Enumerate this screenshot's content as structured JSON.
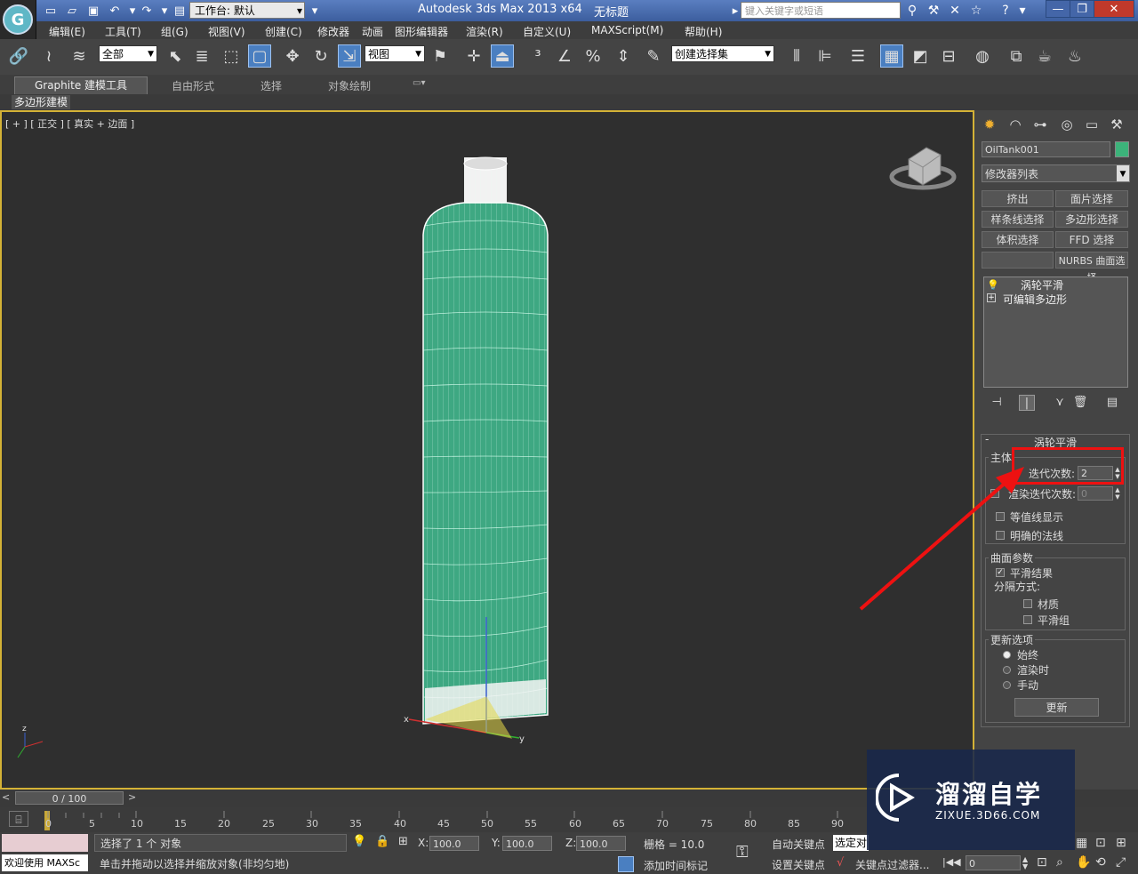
{
  "titlebar": {
    "workspace_label": "工作台: 默认",
    "app_title": "Autodesk 3ds Max  2013 x64",
    "doc_title": "无标题",
    "search_placeholder": "键入关键字或短语"
  },
  "menus": [
    "编辑(E)",
    "工具(T)",
    "组(G)",
    "视图(V)",
    "创建(C)",
    "修改器",
    "动画",
    "图形编辑器",
    "渲染(R)",
    "自定义(U)",
    "MAXScript(M)",
    "帮助(H)"
  ],
  "toolbar": {
    "filter_value": "全部",
    "refcoord_value": "视图",
    "selset_value": "创建选择集"
  },
  "ribbon": {
    "tabs": [
      "Graphite 建模工具",
      "自由形式",
      "选择",
      "对象绘制"
    ],
    "subtab": "多边形建模"
  },
  "viewport": {
    "label": "[ + ] [ 正交 ] [ 真实 + 边面 ]",
    "axis_labels": {
      "x": "x",
      "y": "y",
      "z": "z"
    }
  },
  "command_panel": {
    "object_name": "OilTank001",
    "object_color": "#3cb37a",
    "modifier_list": "修改器列表",
    "modifier_buttons": [
      "挤出",
      "面片选择",
      "样条线选择",
      "多边形选择",
      "体积选择",
      "FFD 选择",
      "",
      "NURBS 曲面选择"
    ],
    "stack": [
      "涡轮平滑",
      "可编辑多边形"
    ]
  },
  "turbosmooth": {
    "title": "涡轮平滑",
    "main_group": "主体",
    "iterations_label": "迭代次数:",
    "iterations_value": "2",
    "render_iters_label": "渲染迭代次数:",
    "render_iters_value": "0",
    "isoline": "等值线显示",
    "explicit_normals": "明确的法线",
    "surface_group": "曲面参数",
    "smooth_result": "平滑结果",
    "separate_by": "分隔方式:",
    "material": "材质",
    "smoothing_group": "平滑组",
    "update_group": "更新选项",
    "always": "始终",
    "when_rendering": "渲染时",
    "manual": "手动",
    "update_button": "更新"
  },
  "timeline": {
    "slider_text": "0 / 100",
    "ticks": [
      "0",
      "5",
      "10",
      "15",
      "20",
      "25",
      "30",
      "35",
      "40",
      "45",
      "50",
      "55",
      "60",
      "65",
      "70",
      "75",
      "80",
      "85",
      "90"
    ]
  },
  "status": {
    "welcome": "欢迎使用 MAXSc",
    "selected": "选择了 1 个 对象",
    "hint": "单击并拖动以选择并缩放对象(非均匀地)",
    "x_label": "X:",
    "x_value": "100.0",
    "y_label": "Y:",
    "y_value": "100.0",
    "z_label": "Z:",
    "z_value": "100.0",
    "grid": "栅格 = 10.0",
    "add_time_tag": "添加时间标记",
    "auto_key": "自动关键点",
    "set_key": "设置关键点",
    "selected_dropdown": "选定对",
    "key_filters": "关键点过滤器...",
    "frame_value": "0"
  },
  "watermark": {
    "name": "溜溜自学",
    "url": "ZIXUE.3D66.COM"
  }
}
